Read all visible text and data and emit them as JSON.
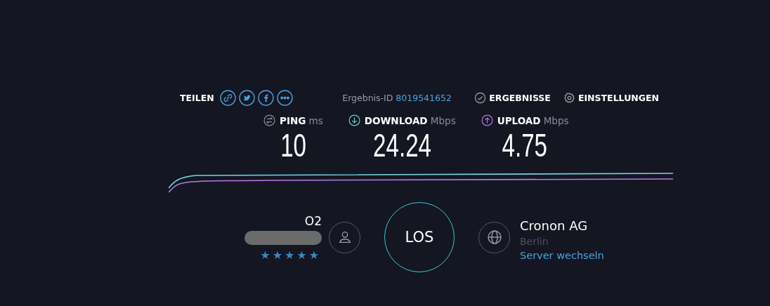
{
  "share": {
    "label": "TEILEN"
  },
  "result": {
    "label": "Ergebnis-ID",
    "id": "8019541652"
  },
  "nav": [
    {
      "label": "ERGEBNISSE",
      "kind": "results"
    },
    {
      "label": "EINSTELLUNGEN",
      "kind": "settings"
    }
  ],
  "metrics": [
    {
      "kind": "ping",
      "name": "PING",
      "unit": "ms",
      "value": "10"
    },
    {
      "kind": "download",
      "name": "DOWNLOAD",
      "unit": "Mbps",
      "value": "24.24"
    },
    {
      "kind": "upload",
      "name": "UPLOAD",
      "unit": "Mbps",
      "value": "4.75"
    }
  ],
  "provider": {
    "name": "O2",
    "stars": 5
  },
  "go_button": {
    "label": "LOS"
  },
  "server": {
    "name": "Cronon AG",
    "city": "Berlin",
    "change_link": "Server wechseln"
  }
}
